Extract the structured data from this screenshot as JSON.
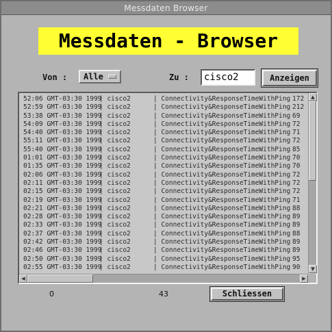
{
  "window": {
    "title": "Messdaten   Browser"
  },
  "banner": {
    "title": "Messdaten - Browser"
  },
  "filters": {
    "from_label": "Von :",
    "from_value": "Alle",
    "to_label": "Zu :",
    "to_value": "cisco2",
    "show_button": "Anzeigen"
  },
  "list": {
    "rows": [
      [
        "52:06 GMT-03:30 1999",
        "| cisco2",
        "| Connectivity&ResponseTimeWithPing",
        "172"
      ],
      [
        "52:59 GMT-03:30 1999",
        "| cisco2",
        "| Connectivity&ResponseTimeWithPing",
        "212"
      ],
      [
        "53:38 GMT-03:30 1999",
        "| cisco2",
        "| Connectivity&ResponseTimeWithPing",
        "69"
      ],
      [
        "54:09 GMT-03:30 1999",
        "| cisco2",
        "| Connectivity&ResponseTimeWithPing",
        "72"
      ],
      [
        "54:40 GMT-03:30 1999",
        "| cisco2",
        "| Connectivity&ResponseTimeWithPing",
        "71"
      ],
      [
        "55:11 GMT-03:30 1999",
        "| cisco2",
        "| Connectivity&ResponseTimeWithPing",
        "72"
      ],
      [
        "55:40 GMT-03:30 1999",
        "| cisco2",
        "| Connectivity&ResponseTimeWithPing",
        "85"
      ],
      [
        "01:01 GMT-03:30 1999",
        "| cisco2",
        "| Connectivity&ResponseTimeWithPing",
        "70"
      ],
      [
        "01:35 GMT-03:30 1999",
        "| cisco2",
        "| Connectivity&ResponseTimeWithPing",
        "70"
      ],
      [
        "02:06 GMT-03:30 1999",
        "| cisco2",
        "| Connectivity&ResponseTimeWithPing",
        "72"
      ],
      [
        "02:11 GMT-03:30 1999",
        "| cisco2",
        "| Connectivity&ResponseTimeWithPing",
        "72"
      ],
      [
        "02:15 GMT-03:30 1999",
        "| cisco2",
        "| Connectivity&ResponseTimeWithPing",
        "72"
      ],
      [
        "02:19 GMT-03:30 1999",
        "| cisco2",
        "| Connectivity&ResponseTimeWithPing",
        "71"
      ],
      [
        "02:21 GMT-03:30 1999",
        "| cisco2",
        "| Connectivity&ResponseTimeWithPing",
        "88"
      ],
      [
        "02:28 GMT-03:30 1999",
        "| cisco2",
        "| Connectivity&ResponseTimeWithPing",
        "89"
      ],
      [
        "02:33 GMT-03:30 1999",
        "| cisco2",
        "| Connectivity&ResponseTimeWithPing",
        "89"
      ],
      [
        "02:37 GMT-03:30 1999",
        "| cisco2",
        "| Connectivity&ResponseTimeWithPing",
        "88"
      ],
      [
        "02:42 GMT-03:30 1999",
        "| cisco2",
        "| Connectivity&ResponseTimeWithPing",
        "89"
      ],
      [
        "02:46 GMT-03:30 1999",
        "| cisco2",
        "| Connectivity&ResponseTimeWithPing",
        "89"
      ],
      [
        "02:50 GMT-03:30 1999",
        "| cisco2",
        "| Connectivity&ResponseTimeWithPing",
        "95"
      ],
      [
        "02:55 GMT-03:30 1999",
        "| cisco2",
        "| Connectivity&ResponseTimeWithPing",
        "90"
      ]
    ]
  },
  "status": {
    "left_value": "0",
    "count": "43",
    "close_button": "Schliessen"
  },
  "colors": {
    "window_bg": "#b4b4b4",
    "banner_bg": "#ffff33",
    "list_bg": "#c8c8c8"
  }
}
